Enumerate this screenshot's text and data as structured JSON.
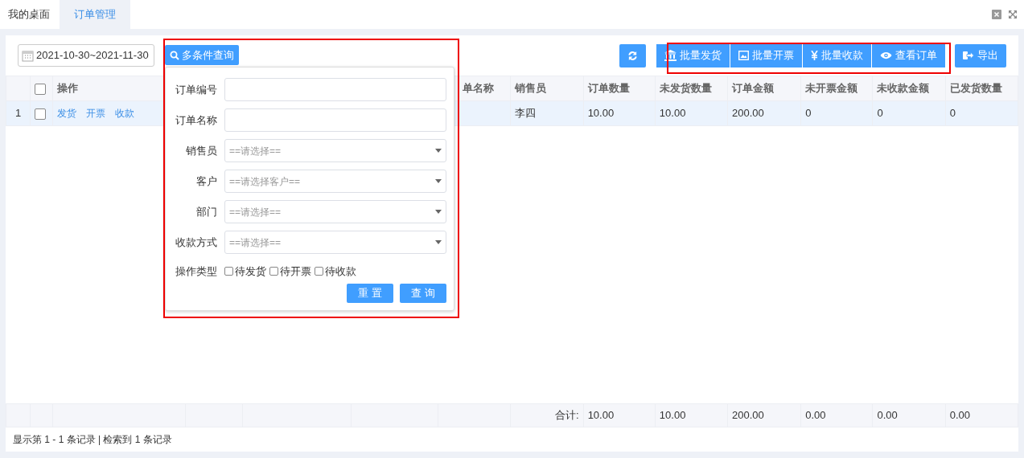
{
  "tabs": [
    {
      "label": "我的桌面",
      "selected": false
    },
    {
      "label": "订单管理",
      "selected": true
    }
  ],
  "toolbar": {
    "date_range": "2021-10-30~2021-11-30",
    "query_button": "多条件查询",
    "buttons": [
      {
        "kind": "refresh"
      },
      {
        "kind": "ship",
        "label": "批量发货"
      },
      {
        "kind": "invoice",
        "label": "批量开票"
      },
      {
        "kind": "payment",
        "label": "批量收款"
      },
      {
        "kind": "view",
        "label": "查看订单"
      },
      {
        "kind": "export",
        "label": "导出"
      }
    ]
  },
  "search_panel": {
    "fields": [
      {
        "kind": "text",
        "label": "订单编号"
      },
      {
        "kind": "text",
        "label": "订单名称"
      },
      {
        "kind": "select",
        "label": "销售员",
        "placeholder": "==请选择=="
      },
      {
        "kind": "select",
        "label": "客户",
        "placeholder": "==请选择客户=="
      },
      {
        "kind": "select",
        "label": "部门",
        "placeholder": "==请选择=="
      },
      {
        "kind": "select",
        "label": "收款方式",
        "placeholder": "==请选择=="
      }
    ],
    "operation_type": {
      "label": "操作类型",
      "options": [
        {
          "label": "待发货",
          "checked": false
        },
        {
          "label": "待开票",
          "checked": false
        },
        {
          "label": "待收款",
          "checked": false
        }
      ]
    },
    "buttons": [
      "重 置",
      "查 询"
    ]
  },
  "table": {
    "header_checked": false,
    "action_header": "操作",
    "columns": [
      "",
      "",
      "",
      "单名称",
      "销售员",
      "订单数量",
      "未发货数量",
      "订单金额",
      "未开票金额",
      "未收款金额",
      "已发货数量"
    ],
    "rows": [
      {
        "index": "1",
        "checked": false,
        "selected": true,
        "actions": [
          "发货",
          "开票",
          "收款"
        ],
        "cells": [
          "",
          "",
          "",
          "",
          "李四",
          "10.00",
          "10.00",
          "200.00",
          "0",
          "0",
          "0"
        ]
      }
    ],
    "totals": {
      "label": "合计:",
      "values": [
        "10.00",
        "10.00",
        "200.00",
        "0.00",
        "0.00",
        "0.00"
      ]
    }
  },
  "status_bar": "显示第 1 - 1 条记录 | 检索到 1 条记录"
}
